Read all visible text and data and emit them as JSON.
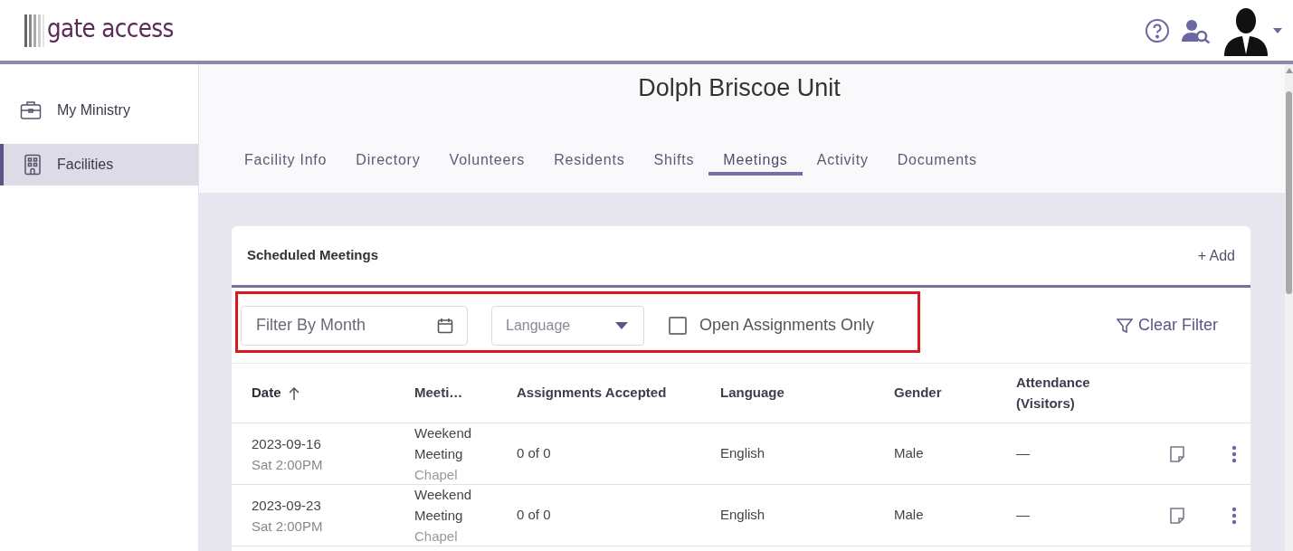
{
  "logo": {
    "text": "gate access"
  },
  "sidebar": {
    "items": [
      {
        "label": "My Ministry",
        "selected": false
      },
      {
        "label": "Facilities",
        "selected": true
      }
    ]
  },
  "page_title": "Dolph Briscoe Unit",
  "tabs": [
    {
      "label": "Facility Info",
      "selected": false
    },
    {
      "label": "Directory",
      "selected": false
    },
    {
      "label": "Volunteers",
      "selected": false
    },
    {
      "label": "Residents",
      "selected": false
    },
    {
      "label": "Shifts",
      "selected": false
    },
    {
      "label": "Meetings",
      "selected": true
    },
    {
      "label": "Activity",
      "selected": false
    },
    {
      "label": "Documents",
      "selected": false
    }
  ],
  "card": {
    "title": "Scheduled Meetings",
    "add_button": "+ Add",
    "filters": {
      "month": {
        "placeholder": "Filter By Month"
      },
      "language": {
        "placeholder": "Language"
      },
      "open_only": {
        "label": "Open Assignments Only",
        "checked": false
      },
      "clear": "Clear Filter"
    },
    "table": {
      "columns": [
        {
          "label": "Date",
          "sorted": true
        },
        {
          "label": "Meeti…",
          "sorted": false
        },
        {
          "label": "Assignments Accepted",
          "sorted": false
        },
        {
          "label": "Language",
          "sorted": false
        },
        {
          "label": "Gender",
          "sorted": false
        },
        {
          "label": "Attendance (Visitors)",
          "sorted": false
        }
      ],
      "rows": [
        {
          "date": "2023-09-16",
          "time": "Sat 2:00PM",
          "meeting": "Weekend Meeting",
          "location": "Chapel",
          "accepted": "0 of 0",
          "language": "English",
          "gender": "Male",
          "attendance": "—"
        },
        {
          "date": "2023-09-23",
          "time": "Sat 2:00PM",
          "meeting": "Weekend Meeting",
          "location": "Chapel",
          "accepted": "0 of 0",
          "language": "English",
          "gender": "Male",
          "attendance": "—"
        }
      ]
    }
  }
}
